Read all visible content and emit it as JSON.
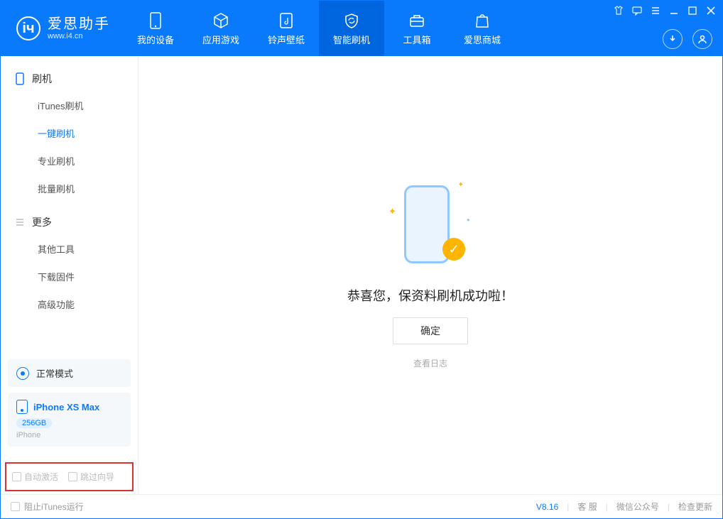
{
  "app": {
    "name": "爱思助手",
    "url": "www.i4.cn"
  },
  "nav": {
    "items": [
      {
        "label": "我的设备"
      },
      {
        "label": "应用游戏"
      },
      {
        "label": "铃声壁纸"
      },
      {
        "label": "智能刷机"
      },
      {
        "label": "工具箱"
      },
      {
        "label": "爱思商城"
      }
    ]
  },
  "sidebar": {
    "group_flash": "刷机",
    "group_more": "更多",
    "items_flash": [
      {
        "label": "iTunes刷机"
      },
      {
        "label": "一键刷机"
      },
      {
        "label": "专业刷机"
      },
      {
        "label": "批量刷机"
      }
    ],
    "items_more": [
      {
        "label": "其他工具"
      },
      {
        "label": "下载固件"
      },
      {
        "label": "高级功能"
      }
    ],
    "mode": "正常模式",
    "device_name": "iPhone XS Max",
    "device_storage": "256GB",
    "device_type": "iPhone",
    "opt_auto_activate": "自动激活",
    "opt_skip_guide": "跳过向导"
  },
  "main": {
    "success_text": "恭喜您，保资料刷机成功啦！",
    "ok_label": "确定",
    "view_log": "查看日志"
  },
  "footer": {
    "block_itunes": "阻止iTunes运行",
    "version": "V8.16",
    "support": "客 服",
    "wechat": "微信公众号",
    "update": "检查更新"
  }
}
